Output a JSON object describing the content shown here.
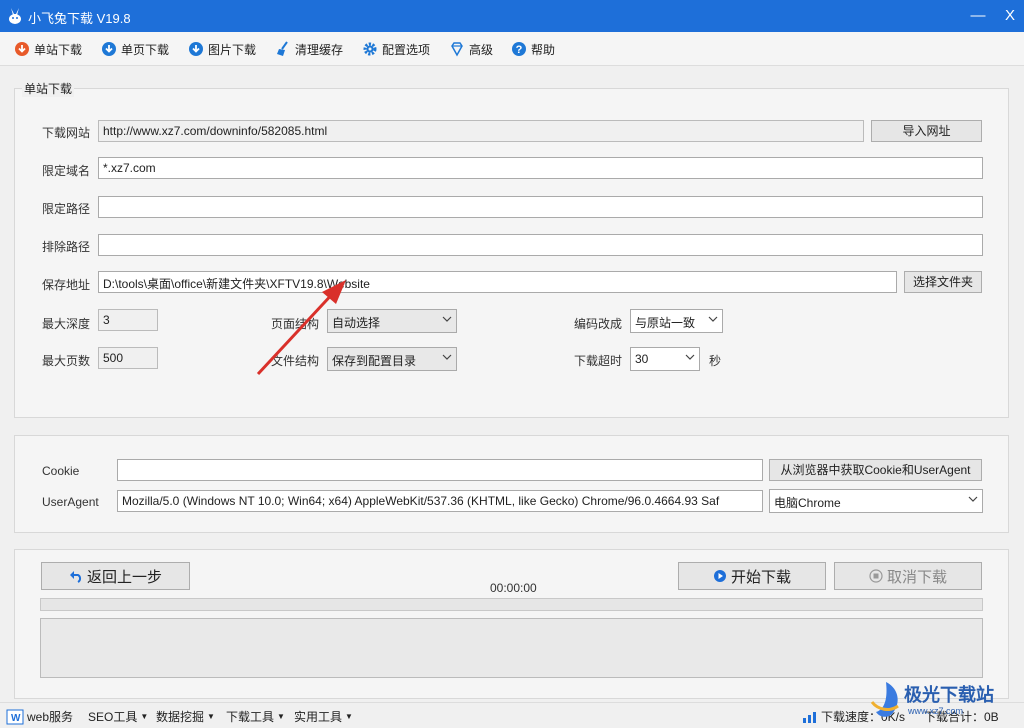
{
  "window": {
    "title": "小飞兔下载 V19.8",
    "minimize": "—",
    "close": "X"
  },
  "toolbar": [
    {
      "label": "单站下载",
      "icon": "download-red-icon"
    },
    {
      "label": "单页下载",
      "icon": "cloud-download-icon"
    },
    {
      "label": "图片下载",
      "icon": "cloud-download-icon"
    },
    {
      "label": "清理缓存",
      "icon": "broom-icon"
    },
    {
      "label": "配置选项",
      "icon": "gear-icon"
    },
    {
      "label": "高级",
      "icon": "diamond-icon"
    },
    {
      "label": "帮助",
      "icon": "help-icon"
    }
  ],
  "single_site": {
    "legend": "单站下载",
    "url": {
      "label": "下载网站",
      "value": "http://www.xz7.com/downinfo/582085.html",
      "button": "导入网址"
    },
    "domain": {
      "label": "限定域名",
      "value": "*.xz7.com"
    },
    "limit_path": {
      "label": "限定路径",
      "value": ""
    },
    "exclude_path": {
      "label": "排除路径",
      "value": ""
    },
    "save_path": {
      "label": "保存地址",
      "value": "D:\\tools\\桌面\\office\\新建文件夹\\XFTV19.8\\Website",
      "button": "选择文件夹"
    },
    "max_depth": {
      "label": "最大深度",
      "value": "3"
    },
    "max_pages": {
      "label": "最大页数",
      "value": "500"
    },
    "page_structure": {
      "label": "页面结构",
      "value": "自动选择"
    },
    "file_structure": {
      "label": "文件结构",
      "value": "保存到配置目录"
    },
    "encoding": {
      "label": "编码改成",
      "value": "与原站一致"
    },
    "timeout": {
      "label": "下载超时",
      "value": "30",
      "unit": "秒"
    }
  },
  "browser": {
    "cookie": {
      "label": "Cookie",
      "value": ""
    },
    "fetch_button": "从浏览器中获取Cookie和UserAgent",
    "useragent": {
      "label": "UserAgent",
      "value": "Mozilla/5.0 (Windows NT 10.0; Win64; x64) AppleWebKit/537.36 (KHTML, like Gecko) Chrome/96.0.4664.93 Saf"
    },
    "ua_preset": "电脑Chrome"
  },
  "actions": {
    "back": "返回上一步",
    "start": "开始下载",
    "cancel": "取消下载",
    "timer": "00:00:00",
    "progress": 0
  },
  "statusbar": {
    "items": [
      {
        "label": "web服务",
        "caret": false
      },
      {
        "label": "SEO工具",
        "caret": true
      },
      {
        "label": "数据挖掘",
        "caret": true
      },
      {
        "label": "下载工具",
        "caret": true
      },
      {
        "label": "实用工具",
        "caret": true
      }
    ],
    "speed": "下载速度：0K/s",
    "total": "下载合计：0B"
  },
  "watermark": {
    "text": "极光下载站",
    "sub": "www.xz7.com"
  },
  "colors": {
    "titlebar": "#1e6fd9",
    "accent": "#1e6fd9",
    "arrow": "#d9302a"
  }
}
